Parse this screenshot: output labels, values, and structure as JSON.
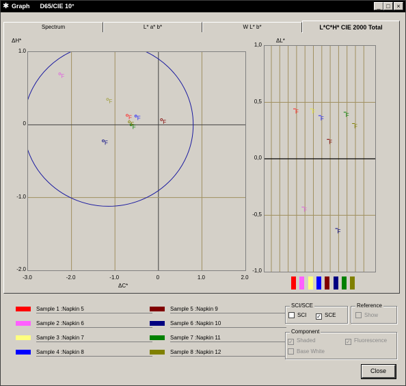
{
  "window": {
    "title": "Graph      D65/CIE 10°",
    "icon": "app-star-icon"
  },
  "tabs": [
    {
      "label": "Spectrum"
    },
    {
      "label": "L* a* b*"
    },
    {
      "label": "W L* b*"
    },
    {
      "label": "L*C*H* CIE 2000 Total",
      "active": true
    }
  ],
  "chart_data": [
    {
      "type": "scatter",
      "xlabel": "ΔC*",
      "ylabel": "ΔH*",
      "xlim": [
        -3.0,
        2.0
      ],
      "ylim": [
        -2.0,
        1.0
      ],
      "x_ticks": [
        "-3.0",
        "-2.0",
        "-1.0",
        "0",
        "1.0",
        "2.0"
      ],
      "y_ticks": [
        "1.0",
        "0",
        "-1.0",
        "-2.0"
      ],
      "grid": true,
      "ellipse": {
        "cx": -1.15,
        "cy": 0.0,
        "rx": 1.95,
        "ry": 1.12,
        "color": "#1a1aa0"
      },
      "points": [
        {
          "x": -0.72,
          "y": 0.13,
          "color": "#ff2020",
          "label": "F"
        },
        {
          "x": -2.27,
          "y": 0.7,
          "color": "#e060e0",
          "label": "F"
        },
        {
          "x": -1.17,
          "y": 0.35,
          "color": "#a0a040",
          "label": "F"
        },
        {
          "x": -0.52,
          "y": 0.12,
          "color": "#2020ff",
          "label": "F"
        },
        {
          "x": 0.07,
          "y": 0.07,
          "color": "#800000",
          "label": "F"
        },
        {
          "x": -1.27,
          "y": -0.22,
          "color": "#000080",
          "label": "F"
        },
        {
          "x": -0.63,
          "y": 0.0,
          "color": "#008000",
          "label": "F"
        },
        {
          "x": -0.67,
          "y": 0.04,
          "color": "#808000",
          "label": "F"
        }
      ]
    },
    {
      "type": "scatter",
      "ylabel": "ΔL*",
      "ylim": [
        -1.0,
        1.0
      ],
      "y_ticks": [
        "1,0",
        "0,5",
        "0,0",
        "-0,5",
        "-1,0"
      ],
      "grid": true,
      "points": [
        {
          "sample": 1,
          "y": 0.43,
          "color": "#ff2020",
          "label": "F"
        },
        {
          "sample": 2,
          "y": -0.44,
          "color": "#e060e0",
          "label": "F"
        },
        {
          "sample": 3,
          "y": 0.43,
          "color": "#e8e840",
          "label": "F"
        },
        {
          "sample": 4,
          "y": 0.37,
          "color": "#2020ff",
          "label": "F"
        },
        {
          "sample": 5,
          "y": 0.16,
          "color": "#800000",
          "label": "F"
        },
        {
          "sample": 6,
          "y": -0.63,
          "color": "#000080",
          "label": "F"
        },
        {
          "sample": 7,
          "y": 0.4,
          "color": "#008000",
          "label": "F"
        },
        {
          "sample": 8,
          "y": 0.3,
          "color": "#808000",
          "label": "F"
        }
      ],
      "bottom_swatches": [
        "#ff0000",
        "#ff60ff",
        "#ffff80",
        "#0000ff",
        "#800000",
        "#000080",
        "#008000",
        "#808000"
      ]
    }
  ],
  "legend": [
    {
      "label": "Sample 1 :Napkin 5",
      "color": "#ff0000"
    },
    {
      "label": "Sample 2 :Napkin 6",
      "color": "#ff60ff"
    },
    {
      "label": "Sample 3 :Napkin 7",
      "color": "#ffff80"
    },
    {
      "label": "Sample 4 :Napkin 8",
      "color": "#0000ff"
    },
    {
      "label": "Sample 5 :Napkin 9",
      "color": "#800000"
    },
    {
      "label": "Sample 6 :Napkin 10",
      "color": "#000080"
    },
    {
      "label": "Sample 7 :Napkin 11",
      "color": "#008000"
    },
    {
      "label": "Sample 8 :Napkin 12",
      "color": "#808000"
    }
  ],
  "sci_sce": {
    "title": "SCI/SCE",
    "sci_label": "SCI",
    "sci_checked": false,
    "sce_label": "SCE",
    "sce_checked": true
  },
  "reference": {
    "title": "Reference",
    "show_label": "Show",
    "checked": false
  },
  "component": {
    "title": "Component",
    "shaded_label": "Shaded",
    "shaded_checked": true,
    "fluorescence_label": "Fluorescence",
    "fluorescence_checked": true,
    "base_white_label": "Base White",
    "base_white_checked": false
  },
  "close_label": "Close"
}
